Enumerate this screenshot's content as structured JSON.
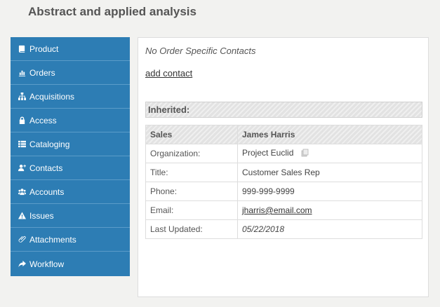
{
  "page": {
    "title": "Abstract and applied analysis"
  },
  "sidebar": {
    "items": [
      {
        "label": "Product",
        "icon": "book-icon"
      },
      {
        "label": "Orders",
        "icon": "bar-chart-icon"
      },
      {
        "label": "Acquisitions",
        "icon": "sitemap-icon"
      },
      {
        "label": "Access",
        "icon": "lock-icon"
      },
      {
        "label": "Cataloging",
        "icon": "list-icon"
      },
      {
        "label": "Contacts",
        "icon": "add-user-icon"
      },
      {
        "label": "Accounts",
        "icon": "users-icon"
      },
      {
        "label": "Issues",
        "icon": "warning-icon"
      },
      {
        "label": "Attachments",
        "icon": "paperclip-icon"
      },
      {
        "label": "Workflow",
        "icon": "share-arrow-icon"
      }
    ]
  },
  "main": {
    "no_contacts_text": "No Order Specific Contacts",
    "add_contact_label": "add contact",
    "inherited_label": "Inherited:",
    "contact": {
      "header_type": "Sales",
      "header_name": "James Harris",
      "rows": [
        {
          "label": "Organization:",
          "value": "Project Euclid"
        },
        {
          "label": "Title:",
          "value": "Customer Sales Rep"
        },
        {
          "label": "Phone:",
          "value": "999-999-9999"
        },
        {
          "label": "Email:",
          "value": "jharris@email.com"
        },
        {
          "label": "Last Updated:",
          "value": "05/22/2018"
        }
      ]
    }
  },
  "colors": {
    "sidebar_bg": "#2d7db4",
    "page_bg": "#f2f2f0"
  }
}
